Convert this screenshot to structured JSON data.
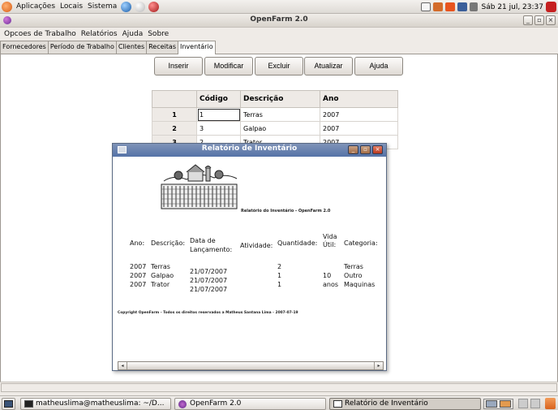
{
  "top_panel": {
    "menus": [
      "Aplicações",
      "Locais",
      "Sistema"
    ],
    "clock": "Sáb 21 jul, 23:37"
  },
  "window": {
    "title": "OpenFarm 2.0",
    "menubar": [
      "Opcoes de Trabalho",
      "Relatórios",
      "Ajuda",
      "Sobre"
    ],
    "tabs": [
      "Fornecedores",
      "Período de Trabalho",
      "Clientes",
      "Receitas",
      "Inventário"
    ],
    "active_tab": "Inventário",
    "toolbar": {
      "insert_label": "Inserir",
      "modify_label": "Modificar",
      "delete_label": "Excluir",
      "refresh_label": "Atualizar",
      "help_label": "Ajuda"
    },
    "table": {
      "headers": [
        "",
        "Código",
        "Descrição",
        "Ano"
      ],
      "rows": [
        {
          "num": "1",
          "codigo": "1",
          "descricao": "Terras",
          "ano": "2007"
        },
        {
          "num": "2",
          "codigo": "3",
          "descricao": "Galpao",
          "ano": "2007"
        },
        {
          "num": "3",
          "codigo": "2",
          "descricao": "Trator",
          "ano": "2007"
        }
      ]
    }
  },
  "report_dialog": {
    "title": "Relatório de Inventário",
    "caption": "Relatório do Inventário - OpenFarm 2.0",
    "headers": {
      "ano": "Ano:",
      "descricao": "Descrição:",
      "data_1": "Data de",
      "data_2": "Lançamento:",
      "atividade": "Atividade:",
      "quantidade": "Quantidade:",
      "vida_1": "Vida",
      "vida_2": "Útil:",
      "categoria": "Categoria:"
    },
    "rows": [
      {
        "ano": "2007",
        "descricao": "Terras",
        "data": "21/07/2007",
        "quantidade": "2",
        "vida": "",
        "categoria": "Terras"
      },
      {
        "ano": "2007",
        "descricao": "Galpao",
        "data": "21/07/2007",
        "quantidade": "1",
        "vida": "10",
        "categoria": "Outro"
      },
      {
        "ano": "2007",
        "descricao": "Trator",
        "data": "21/07/2007",
        "quantidade": "1",
        "vida": "anos",
        "categoria": "Maquinas"
      }
    ],
    "copyright": "Copyright OpenFarm  - Todos os direitos reservados a Matheus Santana Lima - 2007-07-19"
  },
  "taskbar": {
    "tasks": [
      "matheuslima@matheuslima: ~/D...",
      "OpenFarm 2.0",
      "Relatório de Inventário"
    ]
  },
  "colors": {
    "dialog_title_bg": "#5f7bad",
    "desktop_bg": "#efebe7"
  }
}
